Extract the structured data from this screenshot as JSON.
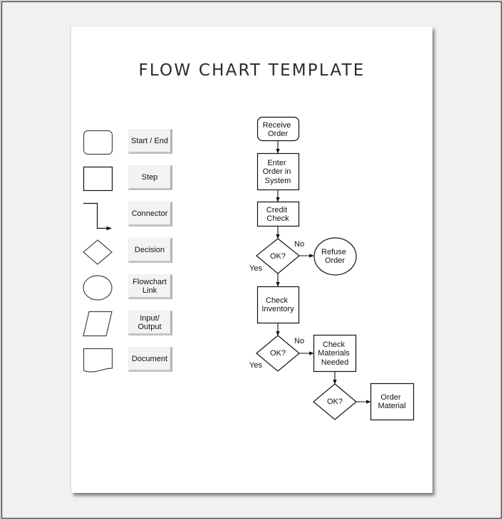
{
  "title": "FLOW CHART TEMPLATE",
  "legend": [
    {
      "shape": "rounded-rectangle",
      "label": "Start / End"
    },
    {
      "shape": "rectangle",
      "label": "Step"
    },
    {
      "shape": "connector-arrow",
      "label": "Connector"
    },
    {
      "shape": "diamond",
      "label": "Decision"
    },
    {
      "shape": "ellipse",
      "label": "Flowchart\nLink"
    },
    {
      "shape": "parallelogram",
      "label": "Input/\nOutput"
    },
    {
      "shape": "document",
      "label": "Document"
    }
  ],
  "flow": {
    "receive_order": [
      "Receive",
      "Order"
    ],
    "enter_order": [
      "Enter",
      "Order in",
      "System"
    ],
    "credit_check": [
      "Credit",
      "Check"
    ],
    "decision1": "OK?",
    "decision1_no": "No",
    "decision1_yes": "Yes",
    "refuse_order": [
      "Refuse",
      "Order"
    ],
    "check_inventory": [
      "Check",
      "Inventory"
    ],
    "decision2": "OK?",
    "decision2_no": "No",
    "decision2_yes": "Yes",
    "check_materials": [
      "Check",
      "Materials",
      "Needed"
    ],
    "decision3": "OK?",
    "order_material": [
      "Order",
      "Material"
    ]
  }
}
